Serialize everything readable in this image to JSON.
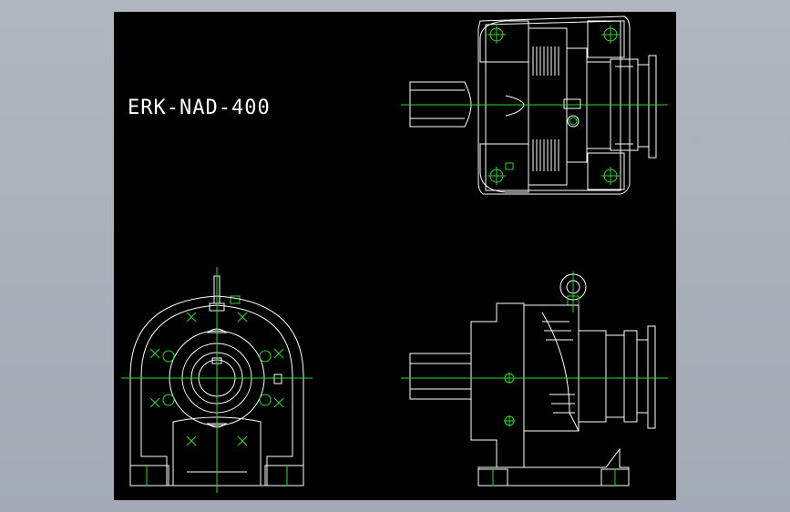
{
  "drawing": {
    "title": "ERK-NAD-400",
    "background_color": "#000000",
    "outline_color": "#ffffff",
    "centerline_color": "#22dd22"
  }
}
